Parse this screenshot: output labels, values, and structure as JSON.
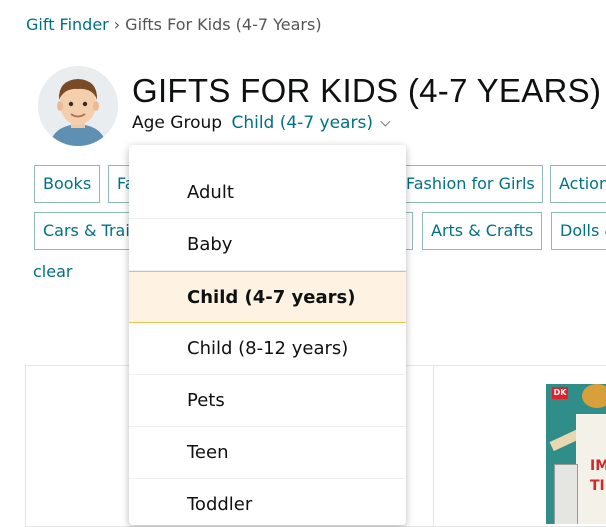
{
  "breadcrumb": {
    "root": "Gift Finder",
    "separator": "›",
    "current": "Gifts For Kids (4-7 Years)"
  },
  "header": {
    "title": "GIFTS FOR KIDS (4-7 YEARS)",
    "age_group_label": "Age Group",
    "age_group_value": "Child (4-7 years)"
  },
  "chips": {
    "row1": [
      "Books",
      "Fa",
      "Fashion for Girls",
      "Action"
    ],
    "row2": [
      "Cars & Trai",
      "Arts & Crafts",
      "Dolls &"
    ],
    "clear": "clear"
  },
  "dropdown": {
    "options": [
      "Adult",
      "Baby",
      "Child (4-7 years)",
      "Child (8-12 years)",
      "Pets",
      "Teen",
      "Toddler"
    ],
    "selected_index": 2
  },
  "product": {
    "publisher_badge": "DK"
  },
  "colors": {
    "link": "#007185",
    "selected_bg": "#fef3e2",
    "selected_border": "#f0c14b"
  }
}
